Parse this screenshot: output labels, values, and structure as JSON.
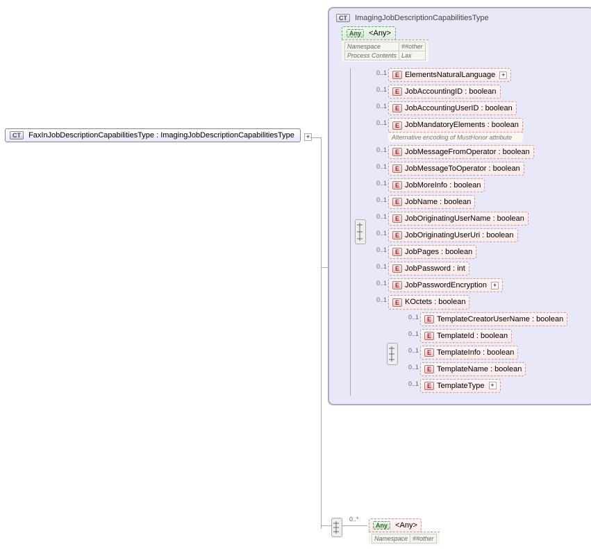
{
  "root": {
    "badge": "CT",
    "label": "FaxInJobDescriptionCapabilitiesType : ImagingJobDescriptionCapabilitiesType"
  },
  "container": {
    "badge": "CT",
    "title": "ImagingJobDescriptionCapabilitiesType"
  },
  "any_top": {
    "badge": "Any",
    "label": "<Any>",
    "ns_k": "Namespace",
    "ns_v": "##other",
    "pc_k": "Process Contents",
    "pc_v": "Lax"
  },
  "occ": "0..1",
  "elems": [
    {
      "label": "ElementsNaturalLanguage",
      "plus": true
    },
    {
      "label": "JobAccountingID : boolean"
    },
    {
      "label": "JobAccountingUserID : boolean"
    },
    {
      "label": "JobMandatoryElements : boolean",
      "note": "Alternative encoding of MustHonor attribute"
    },
    {
      "label": "JobMessageFromOperator : boolean"
    },
    {
      "label": "JobMessageToOperator : boolean"
    },
    {
      "label": "JobMoreInfo : boolean"
    },
    {
      "label": "JobName : boolean"
    },
    {
      "label": "JobOriginatingUserName : boolean"
    },
    {
      "label": "JobOriginatingUserUri : boolean"
    },
    {
      "label": "JobPages : boolean"
    },
    {
      "label": "JobPassword : int"
    },
    {
      "label": "JobPasswordEncryption",
      "plus": true
    },
    {
      "label": "KOctets  : boolean"
    }
  ],
  "subseq": [
    {
      "label": "TemplateCreatorUserName : boolean"
    },
    {
      "label": "TemplateId : boolean"
    },
    {
      "label": "TemplateInfo : boolean"
    },
    {
      "label": "TemplateName : boolean"
    },
    {
      "label": "TemplateType",
      "plus": true
    }
  ],
  "any_bottom": {
    "occ": "0..*",
    "badge": "Any",
    "label": "<Any>",
    "ns_k": "Namespace",
    "ns_v": "##other"
  }
}
